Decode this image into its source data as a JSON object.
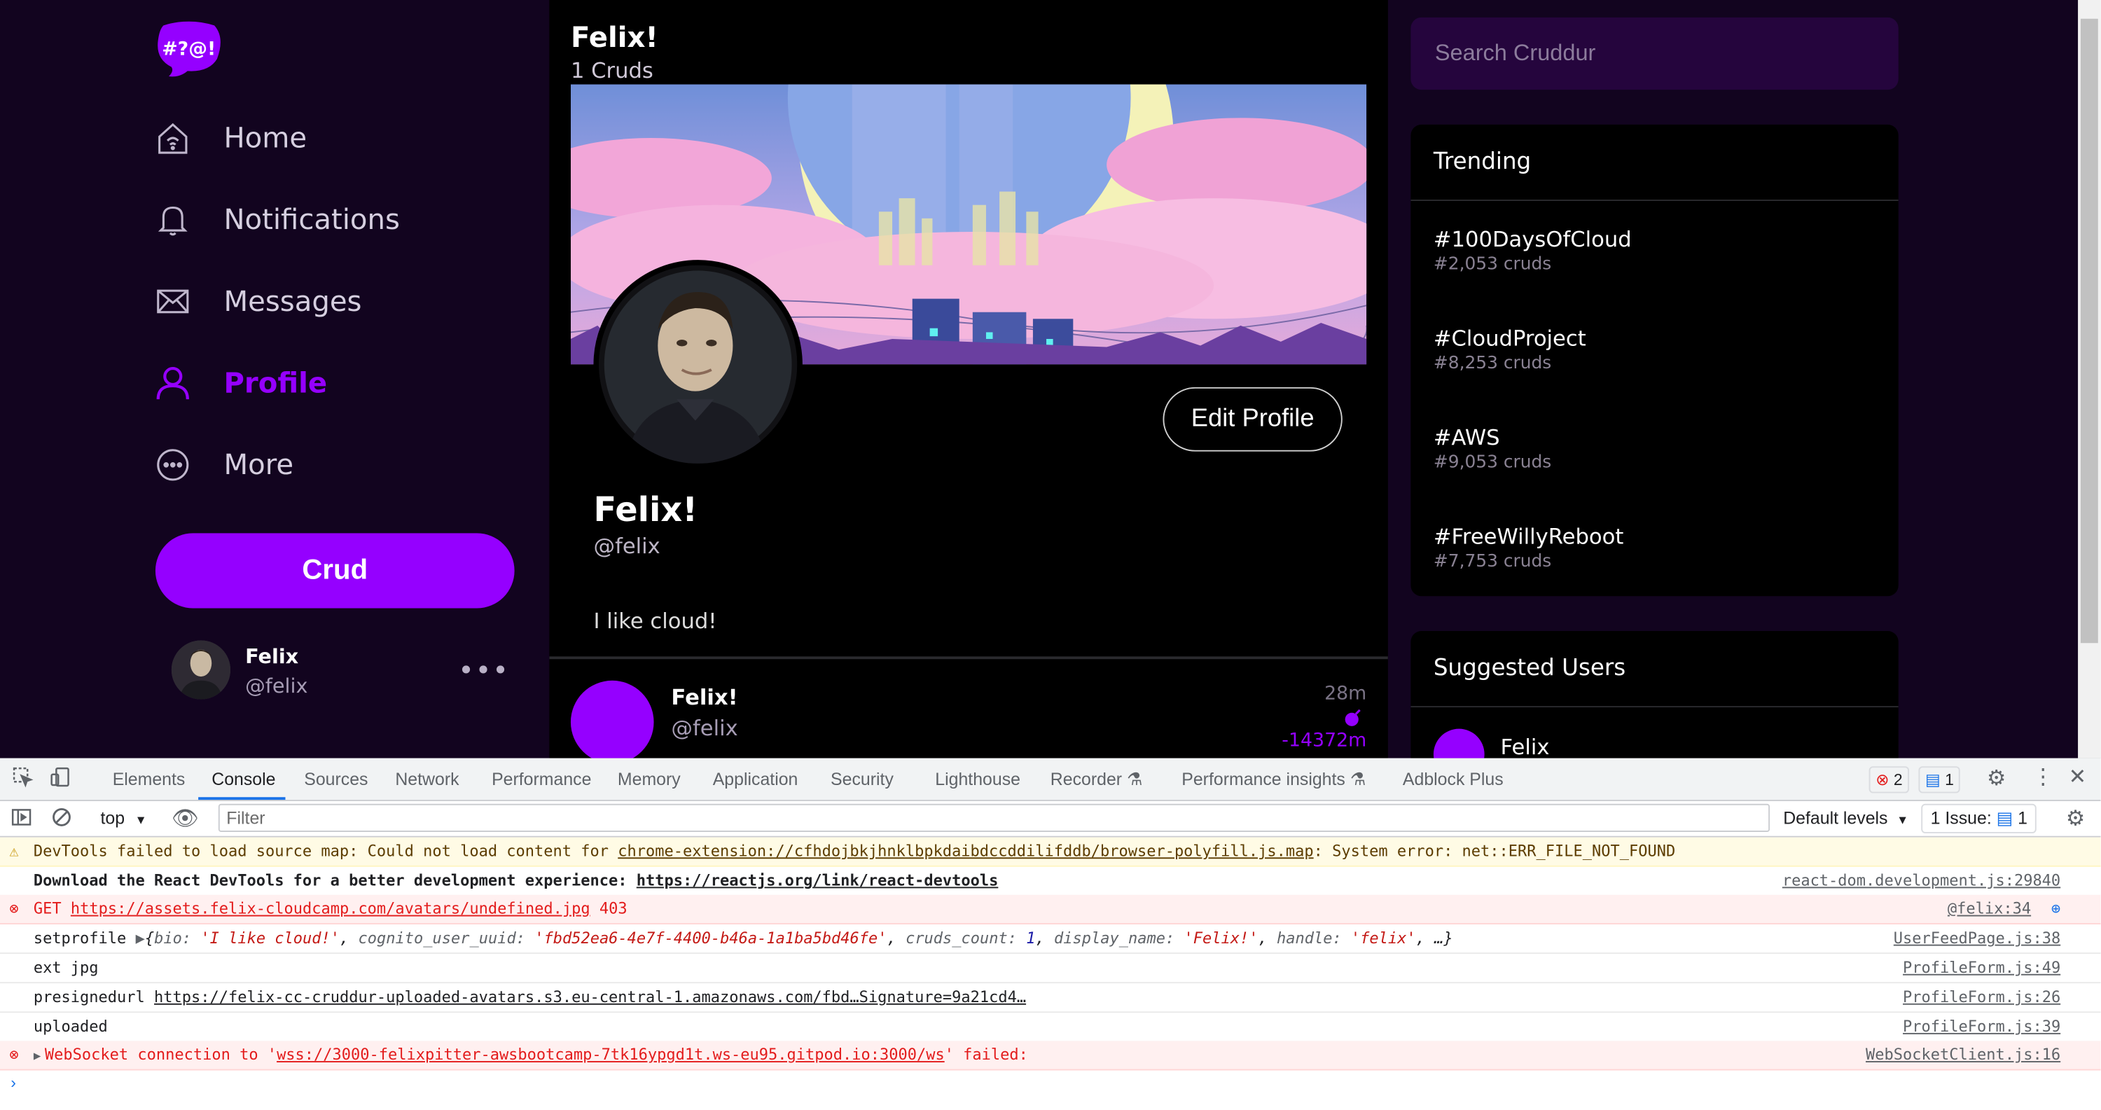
{
  "app": {
    "logo_text": "#?@!"
  },
  "nav": {
    "items": [
      {
        "label": "Home",
        "icon": "home-icon"
      },
      {
        "label": "Notifications",
        "icon": "bell-icon"
      },
      {
        "label": "Messages",
        "icon": "envelope-icon"
      },
      {
        "label": "Profile",
        "icon": "user-icon",
        "active": true
      },
      {
        "label": "More",
        "icon": "more-circle-icon"
      }
    ],
    "crud_button": "Crud"
  },
  "current_user": {
    "name": "Felix",
    "handle": "@felix"
  },
  "profile": {
    "display_name": "Felix!",
    "cruds_count": "1 Cruds",
    "name": "Felix!",
    "handle": "@felix",
    "bio": "I like cloud!",
    "edit_button": "Edit Profile"
  },
  "post": {
    "name": "Felix!",
    "handle": "@felix",
    "time": "28m",
    "expires": "-14372m"
  },
  "search": {
    "placeholder": "Search Cruddur"
  },
  "trending": {
    "title": "Trending",
    "items": [
      {
        "tag": "#100DaysOfCloud",
        "count": "#2,053 cruds"
      },
      {
        "tag": "#CloudProject",
        "count": "#8,253 cruds"
      },
      {
        "tag": "#AWS",
        "count": "#9,053 cruds"
      },
      {
        "tag": "#FreeWillyReboot",
        "count": "#7,753 cruds"
      }
    ]
  },
  "suggested": {
    "title": "Suggested Users",
    "first_user": "Felix"
  },
  "devtools": {
    "tabs": [
      "Elements",
      "Console",
      "Sources",
      "Network",
      "Performance",
      "Memory",
      "Application",
      "Security",
      "Lighthouse",
      "Recorder",
      "Performance insights",
      "Adblock Plus"
    ],
    "active_tab": "Console",
    "error_count": "2",
    "message_count": "1",
    "context": "top",
    "filter_placeholder": "Filter",
    "levels": "Default levels",
    "issues": "1 Issue:",
    "issues_count": "1",
    "colors": {
      "accent": "#1a73e8",
      "error": "#e31c1c",
      "warning": "#fffbe5"
    },
    "log": [
      {
        "level": "warning",
        "text": "DevTools failed to load source map: Could not load content for ",
        "link": "chrome-extension://cfhdojbkjhnklbpkdaibdccddilifddb/browser-polyfill.js.map",
        "tail": ": System error: net::ERR_FILE_NOT_FOUND"
      },
      {
        "level": "info",
        "text": "Download the React DevTools for a better development experience: ",
        "link": "https://reactjs.org/link/react-devtools",
        "source": "react-dom.development.js:29840"
      },
      {
        "level": "error",
        "method": "GET",
        "link": "https://assets.felix-cloudcamp.com/avatars/undefined.jpg",
        "status": "403",
        "source": "@felix:34"
      },
      {
        "level": "info",
        "label": "setprofile",
        "object": {
          "bio": "'I like cloud!'",
          "cognito_user_uuid": "'fbd52ea6-4e7f-4400-b46a-1a1ba5bd46fe'",
          "cruds_count": "1",
          "display_name": "'Felix!'",
          "handle": "'felix'",
          "rest": ", …}"
        },
        "source": "UserFeedPage.js:38"
      },
      {
        "level": "info",
        "text": "ext jpg",
        "source": "ProfileForm.js:49"
      },
      {
        "level": "info",
        "label": "presignedurl",
        "link": "https://felix-cc-cruddur-uploaded-avatars.s3.eu-central-1.amazonaws.com/fbd…Signature=9a21cd4…",
        "source": "ProfileForm.js:26"
      },
      {
        "level": "info",
        "text": "uploaded",
        "source": "ProfileForm.js:39"
      },
      {
        "level": "error",
        "text": "WebSocket connection to '",
        "link": "wss://3000-felixpitter-awsbootcamp-7tk16ypgd1t.ws-eu95.gitpod.io:3000/ws",
        "tail": "' failed:",
        "source": "WebSocketClient.js:16"
      }
    ]
  }
}
